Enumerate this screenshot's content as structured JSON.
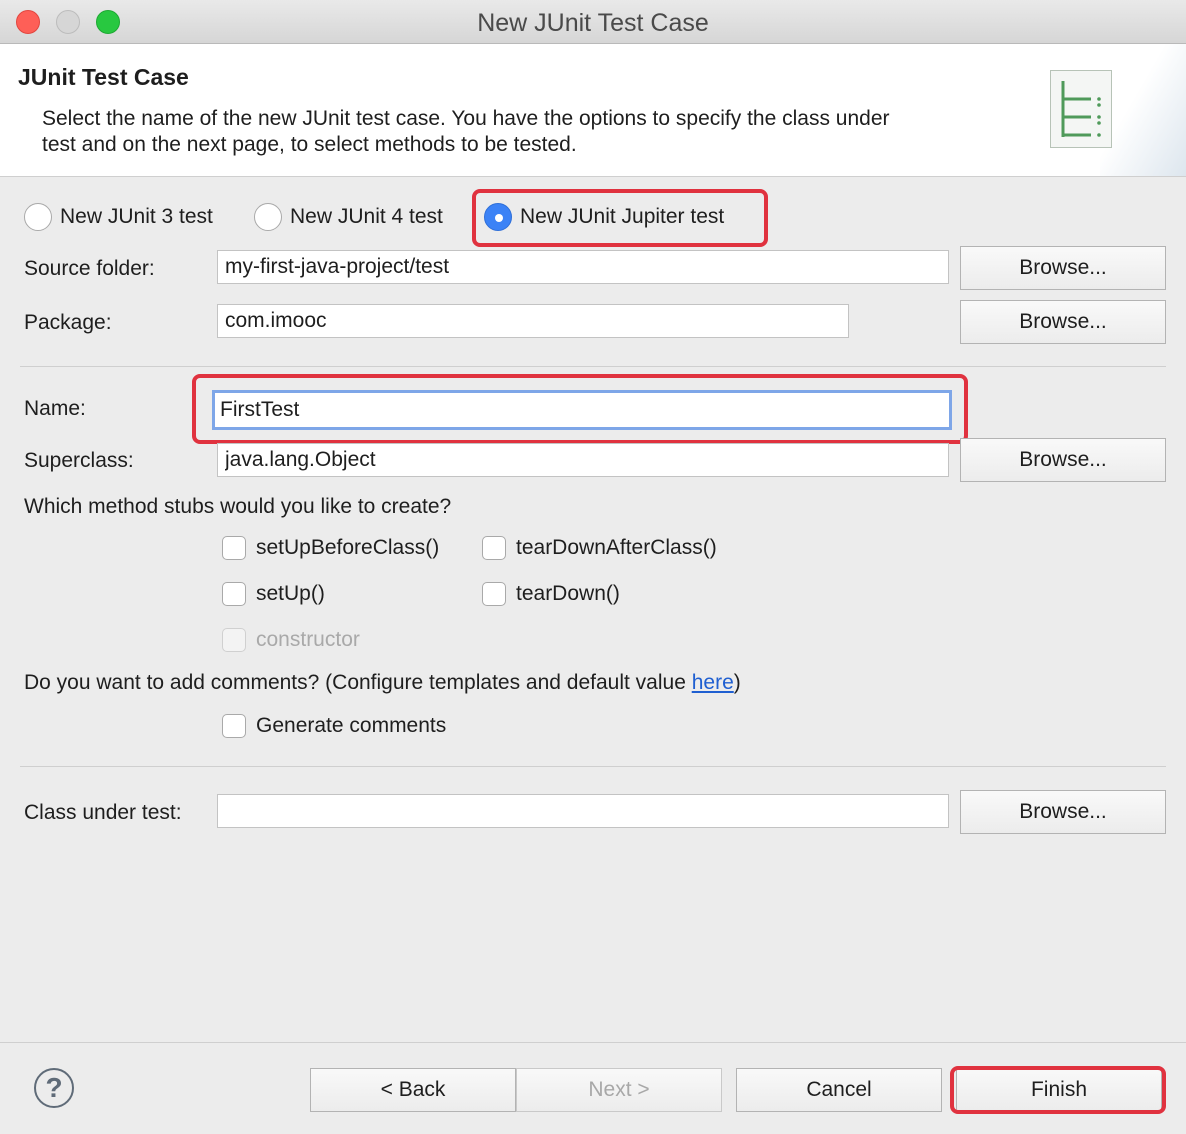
{
  "window": {
    "title": "New JUnit Test Case",
    "colors": {
      "close": "#fe5f57",
      "minimize": "#d6d6d6",
      "zoom": "#28c840"
    }
  },
  "header": {
    "title": "JUnit Test Case",
    "description": "Select the name of the new JUnit test case. You have the options to specify the class under test and on the next page, to select methods to be tested.",
    "icon": "junit-wizard-icon"
  },
  "junit_version": {
    "options": [
      "New JUnit 3 test",
      "New JUnit 4 test",
      "New JUnit Jupiter test"
    ],
    "selected": "New JUnit Jupiter test"
  },
  "form": {
    "source_folder": {
      "label": "Source folder:",
      "value": "my-first-java-project/test",
      "browse": "Browse..."
    },
    "package": {
      "label": "Package:",
      "value": "com.imooc",
      "browse": "Browse..."
    },
    "name": {
      "label": "Name:",
      "value": "FirstTest"
    },
    "superclass": {
      "label": "Superclass:",
      "value": "java.lang.Object",
      "browse": "Browse..."
    }
  },
  "stubs": {
    "question": "Which method stubs would you like to create?",
    "setUpBeforeClass": "setUpBeforeClass()",
    "tearDownAfterClass": "tearDownAfterClass()",
    "setUp": "setUp()",
    "tearDown": "tearDown()",
    "constructor": "constructor"
  },
  "comments": {
    "question_prefix": "Do you want to add comments? (Configure templates and default value ",
    "link": "here",
    "question_suffix": ")",
    "generate": "Generate comments"
  },
  "class_under_test": {
    "label": "Class under test:",
    "value": "",
    "browse": "Browse..."
  },
  "footer": {
    "help": "?",
    "back": "< Back",
    "next": "Next >",
    "cancel": "Cancel",
    "finish": "Finish"
  },
  "highlight_color": "#e0323f"
}
